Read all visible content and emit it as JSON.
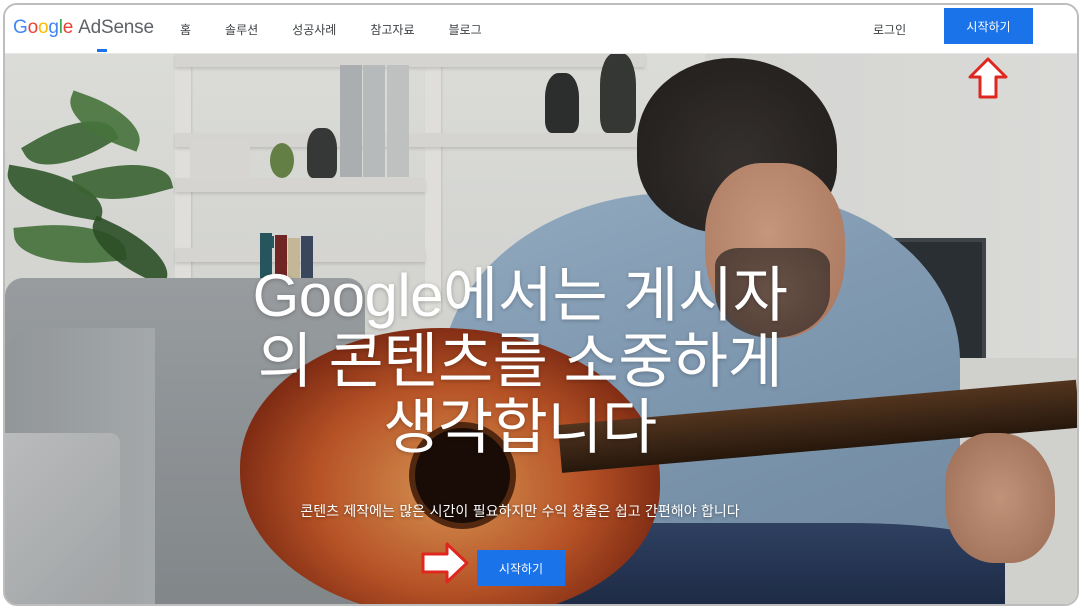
{
  "header": {
    "logo_google": "Google",
    "logo_product": "AdSense",
    "nav": [
      {
        "label": "홈",
        "active": true
      },
      {
        "label": "솔루션",
        "active": false
      },
      {
        "label": "성공사례",
        "active": false
      },
      {
        "label": "참고자료",
        "active": false
      },
      {
        "label": "블로그",
        "active": false
      }
    ],
    "login_label": "로그인",
    "start_label": "시작하기"
  },
  "hero": {
    "title_line1": "Google에서는 게시자",
    "title_line2": "의 콘텐츠를 소중하게",
    "title_line3": "생각합니다",
    "subtitle": "콘텐츠 제작에는 많은 시간이 필요하지만 수익 창출은 쉽고 간편해야 합니다",
    "cta_label": "시작하기"
  },
  "colors": {
    "accent": "#1a73e8",
    "annotation": "#e0271f"
  },
  "icons": [
    "up-arrow-annotation-icon",
    "right-arrow-annotation-icon"
  ]
}
